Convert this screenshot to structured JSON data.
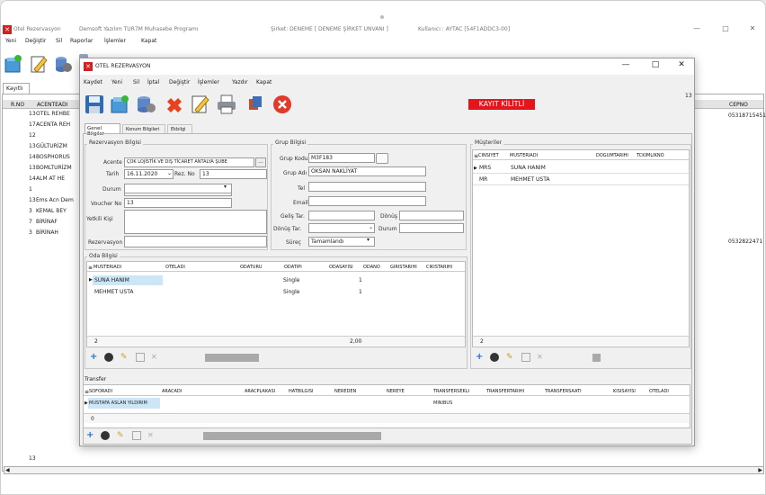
{
  "outer": {
    "title": "Otel Rezervasyon",
    "subtitle": "Demsoft Yazılım   TUR7M Muhasebe Programı",
    "company": "Şirket: DENEME [ DENEME ŞİRKET UNVANI ]",
    "user": "Kullanıcı : AYTAC [54F1ADDC3-00]",
    "menu": [
      "Yeni",
      "Değiştir",
      "Sil",
      "Raporlar",
      "İşlemler",
      "Kapat"
    ],
    "tab": "Kayıtlı",
    "grid_headers": [
      "R.NO",
      "ACENTEADI"
    ],
    "grid_rows": [
      {
        "no": "13",
        "name": "OTEL REHBE"
      },
      {
        "no": "17",
        "name": "ACENTA REH"
      },
      {
        "no": "12",
        "name": ""
      },
      {
        "no": "13",
        "name": "GÜLTURİZM"
      },
      {
        "no": "14",
        "name": "BOSPHORUS"
      },
      {
        "no": "13",
        "name": "BOMLTURİZM"
      },
      {
        "no": "14",
        "name": "ALM AT HE"
      },
      {
        "no": "1",
        "name": ""
      },
      {
        "no": "13",
        "name": "Ems Acn Dem"
      },
      {
        "no": "3",
        "name": "KEMAL BEY"
      },
      {
        "no": "7",
        "name": "BİRİNAF"
      },
      {
        "no": "3",
        "name": "BİRİNAH"
      }
    ],
    "right_header": "CEPNO",
    "right_values": [
      "05318715451",
      "0532822471"
    ],
    "footer_count": "13"
  },
  "dialog": {
    "title": "OTEL REZERVASYON",
    "menu": [
      "Kaydet",
      "Yeni",
      "Sil",
      "İptal",
      "Değiştir",
      "İşlemler",
      "Yazdır",
      "Kapat"
    ],
    "locked_label": "KAYIT KİLİTLİ",
    "corner_num": "13",
    "tabs": [
      "Genel Bilgiler",
      "Konum Bilgileri",
      "Ekbilgi"
    ],
    "rez": {
      "title": "Rezervasyon Bilgisi",
      "acente_label": "Acente",
      "acente_value": "ÇOK LOJİSTİK VE DIŞ TİCARET ANTALYA ŞUBE",
      "tarih_label": "Tarih",
      "tarih_value": "16.11.2020",
      "rez_no_label": "Rez. No",
      "rez_no_value": "13",
      "durum_label": "Durum",
      "voucher_label": "Voucher No",
      "voucher_value": "13",
      "yetkili_label": "Yetkili Kişi",
      "aciklama_label": "Rezervasyon"
    },
    "grup": {
      "title": "Grup Bilgisi",
      "grup_kodu_label": "Grup Kodu",
      "grup_kodu_value": "M3F183",
      "grup_adi_label": "Grup Adı",
      "grup_adi_value": "OKSAN NAKLİYAT",
      "tel_label": "Tel",
      "email_label": "Email",
      "gelis_label": "Geliş Tar.",
      "donus_label": "Dönüş Tar.",
      "dongu_label": "Dönüş",
      "durum_label": "Durum",
      "surec_label": "Süreç",
      "surec_value": "Tamamlandı"
    },
    "oda": {
      "title": "Oda Bilgisi",
      "headers": [
        "MUSTERIADI",
        "OTELADI",
        "ODATURU",
        "ODATIPI",
        "ODASAYISI",
        "ODANO",
        "GIRISTARIHI",
        "CIKISTARIHI"
      ],
      "rows": [
        {
          "musteri": "SUNA HANIM",
          "oteladi": "",
          "odaturu": "",
          "odatipi": "Single",
          "odasayisi": "1"
        },
        {
          "musteri": "MEHMET USTA",
          "oteladi": "",
          "odaturu": "",
          "odatipi": "Single",
          "odasayisi": "1"
        }
      ],
      "count": "2",
      "total": "2,00"
    },
    "musteriler": {
      "title": "Müşteriler",
      "headers": [
        "CINSIYET",
        "MUSTERIADI",
        "DOGUMTARIHI",
        "TCKIMLIKNO"
      ],
      "rows": [
        {
          "cinsiyet": "MRS",
          "ad": "SUNA HANIM"
        },
        {
          "cinsiyet": "MR",
          "ad": "MEHMET USTA"
        }
      ],
      "count": "2"
    },
    "transfer": {
      "title": "Transfer",
      "headers": [
        "SOFORADI",
        "ARACADI",
        "ARACPLAKASI",
        "HATBILGISI",
        "NEREDEN",
        "NEREYE",
        "TRANSFERSEKLI",
        "TRANSFERTARIHI",
        "TRANSFERSAATI",
        "KISISAYISI",
        "OTELADI"
      ],
      "row": {
        "sofor": "MUSTAFA ASLAN YILDIRIM",
        "sekil": "MINIBUS"
      },
      "count": "0"
    }
  },
  "colors": {
    "accent": "#d32020",
    "locked": "#e8141b",
    "select": "#cde6f7"
  }
}
